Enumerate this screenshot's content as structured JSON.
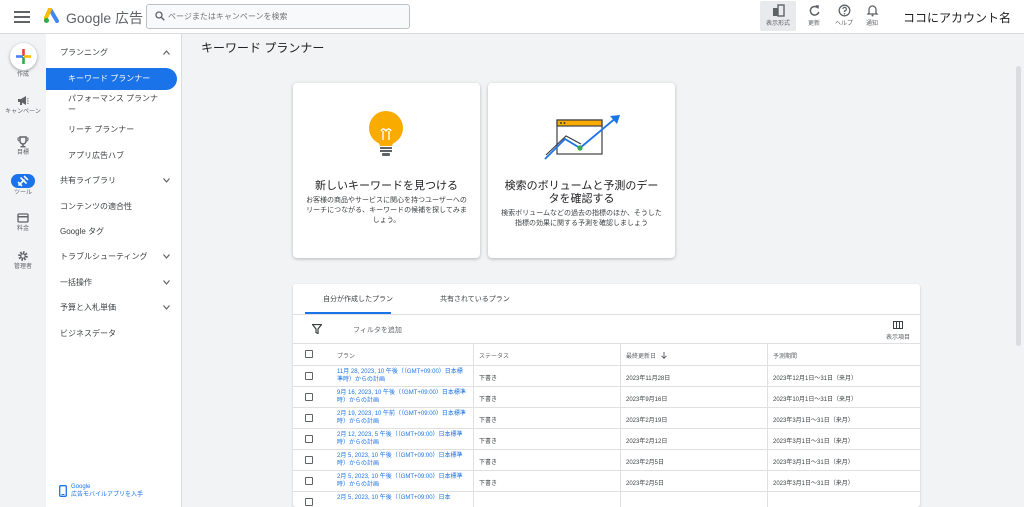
{
  "app": {
    "product": "Google 広告",
    "account_name": "ココにアカウント名"
  },
  "search": {
    "placeholder": "ページまたはキャンペーンを検索",
    "value": ""
  },
  "toolbar": {
    "view_label": "表示形式",
    "refresh_label": "更新",
    "help_label": "ヘルプ",
    "notifications_label": "通知"
  },
  "rail": {
    "items": [
      {
        "label": "作成",
        "icon": "plus-icon"
      },
      {
        "label": "キャンペーン",
        "icon": "megaphone-icon"
      },
      {
        "label": "目標",
        "icon": "trophy-icon"
      },
      {
        "label": "ツール",
        "icon": "tools-icon"
      },
      {
        "label": "料金",
        "icon": "billing-icon"
      },
      {
        "label": "管理者",
        "icon": "gear-icon"
      }
    ]
  },
  "nav": {
    "items": [
      {
        "label": "プランニング",
        "expanded": true
      },
      {
        "label": "キーワード プランナー",
        "active": true
      },
      {
        "label": "パフォーマンス プランナー"
      },
      {
        "label": "リーチ プランナー"
      },
      {
        "label": "アプリ広告ハブ"
      },
      {
        "label": "共有ライブラリ"
      },
      {
        "label": "コンテンツの適合性"
      },
      {
        "label": "Google タグ"
      },
      {
        "label": "トラブルシューティング"
      },
      {
        "label": "一括操作"
      },
      {
        "label": "予算と入札単価"
      },
      {
        "label": "ビジネスデータ"
      }
    ],
    "footer_line1": "Google",
    "footer_line2": "広告モバイルアプリを入手"
  },
  "main": {
    "title": "キーワード プランナー",
    "cards": [
      {
        "title": "新しいキーワードを見つける",
        "description": "お客様の商品やサービスに関心を持つユーザーへのリーチにつながる、キーワードの候補を探してみましょう。",
        "icon": "lightbulb-icon"
      },
      {
        "title": "検索のボリュームと予測のデータを確認する",
        "description": "検索ボリュームなどの過去の指標のほか、そうした指標の効果に関する予測を確認しましょう",
        "icon": "trend-chart-icon"
      }
    ]
  },
  "plans": {
    "tabs": [
      "自分が作成したプラン",
      "共有されているプラン"
    ],
    "filter_label": "フィルタを追加",
    "columns_label": "表示項目",
    "headers": [
      "プラン",
      "ステータス",
      "最終更新日",
      "予測期間"
    ],
    "rows": [
      {
        "plan": "11月 28, 2023, 10 午後（（GMT+09:00）日本標準時）からの計画",
        "status": "下書き",
        "updated": "2023年11月28日",
        "period": "2023年12月1日～31日（来月）"
      },
      {
        "plan": "9月 16, 2023, 10 午後（（GMT+09:00）日本標準時）からの計画",
        "status": "下書き",
        "updated": "2023年9月16日",
        "period": "2023年10月1日～31日（来月）"
      },
      {
        "plan": "2月 19, 2023, 10 午前（（GMT+09:00）日本標準時）からの計画",
        "status": "下書き",
        "updated": "2023年2月19日",
        "period": "2023年3月1日～31日（来月）"
      },
      {
        "plan": "2月 12, 2023, 5 午後（（GMT+09:00）日本標準時）からの計画",
        "status": "下書き",
        "updated": "2023年2月12日",
        "period": "2023年3月1日～31日（来月）"
      },
      {
        "plan": "2月 5, 2023, 10 午後（（GMT+09:00）日本標準時）からの計画",
        "status": "下書き",
        "updated": "2023年2月5日",
        "period": "2023年3月1日～31日（来月）"
      },
      {
        "plan": "2月 5, 2023, 10 午後（（GMT+09:00）日本標準時）からの計画",
        "status": "下書き",
        "updated": "2023年2月5日",
        "period": "2023年3月1日～31日（来月）"
      },
      {
        "plan": "2月 5, 2023, 10 午後（（GMT+09:00）日本",
        "status": "",
        "updated": "",
        "period": ""
      }
    ]
  },
  "colors": {
    "accent": "#1a73e8",
    "bulb": "#f9ab00"
  }
}
